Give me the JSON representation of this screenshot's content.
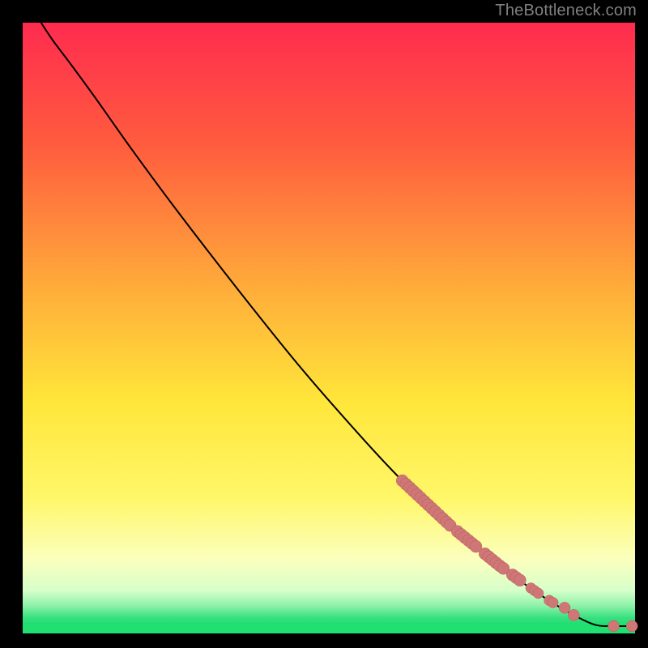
{
  "attribution": "TheBottleneck.com",
  "colors": {
    "curve": "#000000",
    "marker_fill": "#cf7676",
    "marker_stroke": "#b85c5c",
    "axis_green": "#1fe071"
  },
  "chart_data": {
    "type": "line",
    "title": "",
    "xlabel": "",
    "ylabel": "",
    "xlim": [
      0,
      100
    ],
    "ylim": [
      0,
      100
    ],
    "gradient_stops": [
      {
        "offset": 0.0,
        "color": "#ff2b4f"
      },
      {
        "offset": 0.2,
        "color": "#ff5c3e"
      },
      {
        "offset": 0.45,
        "color": "#ffb13a"
      },
      {
        "offset": 0.62,
        "color": "#ffe63a"
      },
      {
        "offset": 0.78,
        "color": "#fff76a"
      },
      {
        "offset": 0.88,
        "color": "#fbffbe"
      },
      {
        "offset": 0.93,
        "color": "#d6ffca"
      },
      {
        "offset": 0.955,
        "color": "#8cf2a8"
      },
      {
        "offset": 0.975,
        "color": "#34e07e"
      },
      {
        "offset": 1.0,
        "color": "#1fd873"
      }
    ],
    "curve": [
      {
        "x": 3.0,
        "y": 100.0
      },
      {
        "x": 5.0,
        "y": 97.0
      },
      {
        "x": 8.0,
        "y": 93.0
      },
      {
        "x": 12.0,
        "y": 87.5
      },
      {
        "x": 18.0,
        "y": 79.0
      },
      {
        "x": 25.0,
        "y": 69.5
      },
      {
        "x": 35.0,
        "y": 56.5
      },
      {
        "x": 45.0,
        "y": 44.0
      },
      {
        "x": 55.0,
        "y": 32.5
      },
      {
        "x": 62.0,
        "y": 25.0
      },
      {
        "x": 70.0,
        "y": 17.5
      },
      {
        "x": 78.0,
        "y": 11.0
      },
      {
        "x": 85.0,
        "y": 6.0
      },
      {
        "x": 90.0,
        "y": 3.0
      },
      {
        "x": 93.5,
        "y": 1.4
      },
      {
        "x": 96.0,
        "y": 1.2
      },
      {
        "x": 98.0,
        "y": 1.2
      },
      {
        "x": 100.0,
        "y": 1.2
      }
    ],
    "marker_clusters": [
      {
        "x_start": 62.0,
        "x_end": 70.0,
        "thick": true
      },
      {
        "x_start": 71.0,
        "x_end": 74.0,
        "thick": true
      },
      {
        "x_start": 75.5,
        "x_end": 79.0,
        "thick": true
      },
      {
        "x_start": 80.0,
        "x_end": 81.5,
        "thick": true
      },
      {
        "x_start": 83.0,
        "x_end": 84.5,
        "thick": false
      },
      {
        "x_start": 86.0,
        "x_end": 87.0,
        "thick": false
      }
    ],
    "isolated_markers": [
      {
        "x": 88.5,
        "y": 4.2
      },
      {
        "x": 90.0,
        "y": 3.0
      },
      {
        "x": 96.5,
        "y": 1.2
      },
      {
        "x": 99.5,
        "y": 1.2
      }
    ]
  }
}
